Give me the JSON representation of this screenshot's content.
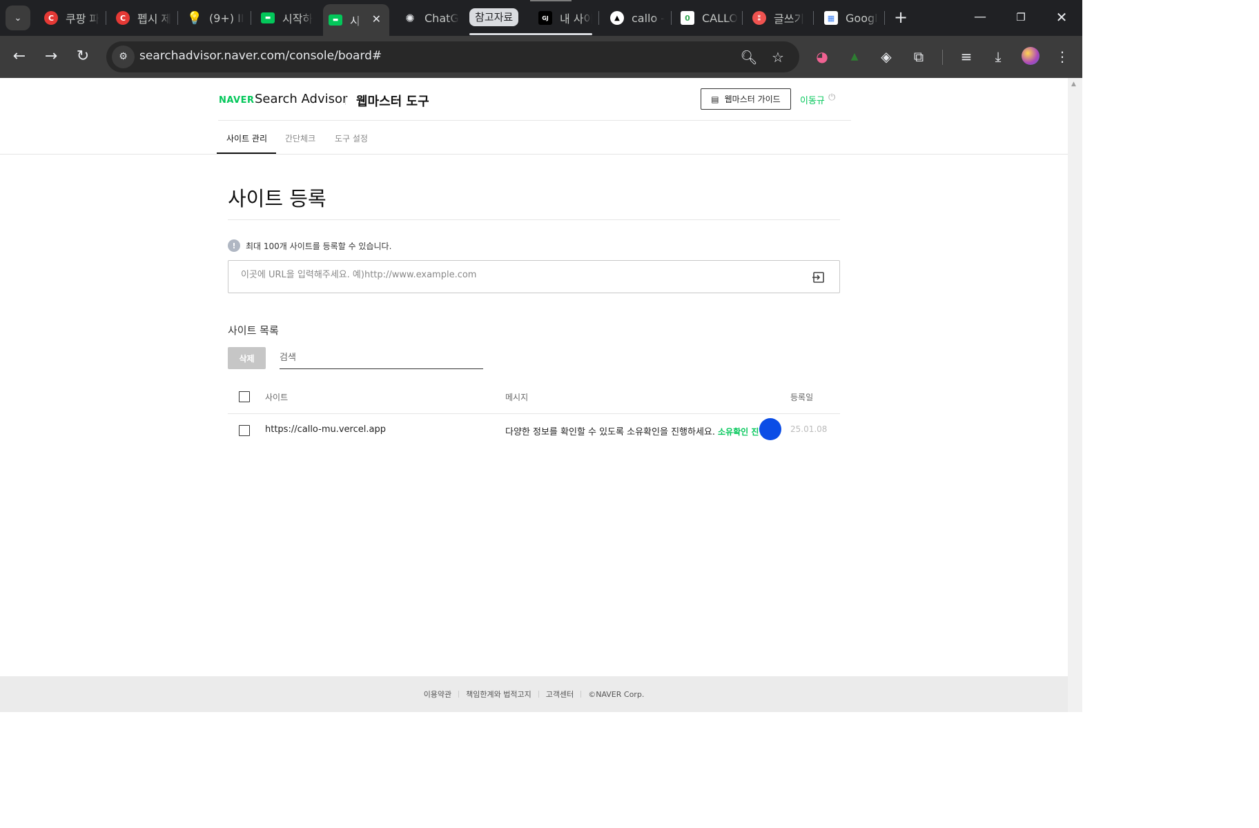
{
  "browser": {
    "tabs": [
      {
        "title": "쿠팡 파",
        "favicon": "coupang-icon",
        "color": "#e53935",
        "glyph": "C"
      },
      {
        "title": "펩시 제",
        "favicon": "coupang-icon",
        "color": "#e53935",
        "glyph": "C"
      },
      {
        "title": "(9+) II",
        "favicon": "lightbulb-icon",
        "color": "#fbc02d",
        "glyph": "💡"
      },
      {
        "title": "시작하",
        "favicon": "naver-console-icon",
        "color": "#03c75a",
        "glyph": "▬"
      },
      {
        "title": "시",
        "favicon": "naver-console-icon",
        "color": "#03c75a",
        "glyph": "▬",
        "active": true
      },
      {
        "title": "ChatG",
        "favicon": "chatgpt-icon",
        "color": "#202124",
        "glyph": "✺"
      },
      {
        "title": "내 사이",
        "favicon": "gj-icon",
        "color": "#000000",
        "glyph": "GJ"
      },
      {
        "title": "callo -",
        "favicon": "vercel-icon",
        "color": "#ffffff",
        "glyph": "▲"
      },
      {
        "title": "CALLO",
        "favicon": "callo-icon",
        "color": "#34a853",
        "glyph": "0"
      },
      {
        "title": "글쓰기",
        "favicon": "write-icon",
        "color": "#ef5350",
        "glyph": "⁑"
      },
      {
        "title": "Googl",
        "favicon": "google-business-icon",
        "color": "#4285f4",
        "glyph": "▦"
      }
    ],
    "tab_group_label": "참고자료",
    "url": "searchadvisor.naver.com/console/board#"
  },
  "header": {
    "logo": "NAVER",
    "brand": "Search Advisor",
    "tool_title": "웹마스터 도구",
    "guide_button": "웹마스터 가이드",
    "user_name": "이동규"
  },
  "nav": {
    "tabs": [
      "사이트 관리",
      "간단체크",
      "도구 설정"
    ]
  },
  "main": {
    "title": "사이트 등록",
    "notice": "최대 100개 사이트를 등록할 수 있습니다.",
    "url_input": {
      "value": "",
      "placeholder": "이곳에 URL을 입력해주세요. 예)http://www.example.com"
    },
    "list_title": "사이트 목록",
    "delete_button": "삭제",
    "search": {
      "value": "",
      "placeholder": "검색"
    },
    "table": {
      "headers": {
        "site": "사이트",
        "message": "메시지",
        "date": "등록일"
      },
      "rows": [
        {
          "site": "https://callo-mu.vercel.app",
          "message": "다양한 정보를 확인할 수 있도록 소유확인을 진행하세요.",
          "action": "소유확인 진행",
          "date": "25.01.08"
        }
      ]
    }
  },
  "footer": {
    "links": [
      "이용약관",
      "책임한계와 법적고지",
      "고객센터",
      "©NAVER Corp."
    ]
  },
  "colors": {
    "naver_green": "#03c75a",
    "cursor_blue": "#0b4de6",
    "chrome_dark": "#202124"
  }
}
